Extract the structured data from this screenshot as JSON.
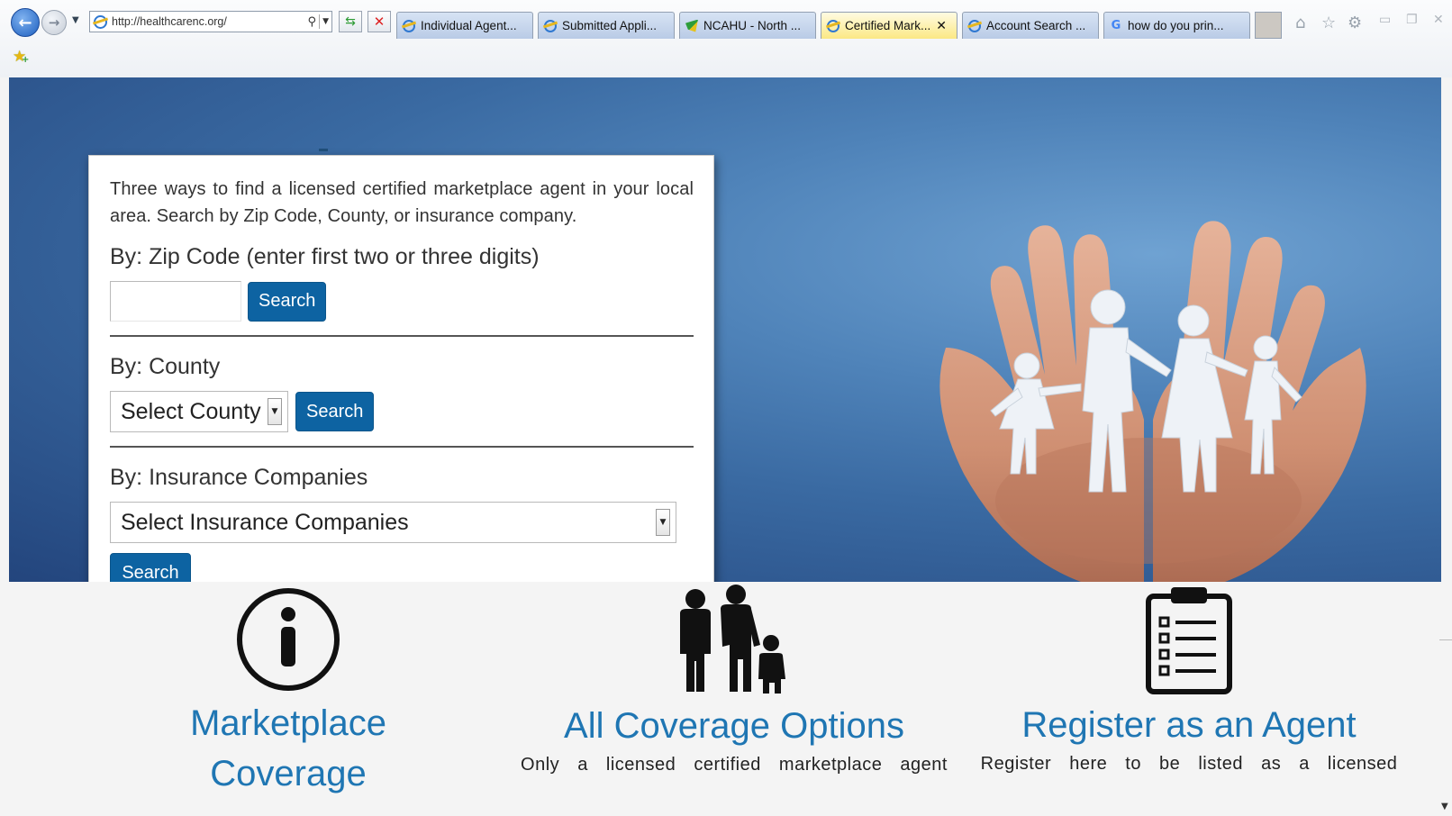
{
  "browser": {
    "address": "http://healthcarenc.org/",
    "tabs": [
      {
        "label": "Individual Agent...",
        "icon": "ie-icon",
        "active": false
      },
      {
        "label": "Submitted Appli...",
        "icon": "ie-icon",
        "active": false
      },
      {
        "label": "NCAHU - North ...",
        "icon": "ncahu-flag-icon",
        "active": false
      },
      {
        "label": "Certified Mark...",
        "icon": "ie-icon",
        "active": true
      },
      {
        "label": "Account Search ...",
        "icon": "ie-icon",
        "active": false
      },
      {
        "label": "how do you prin...",
        "icon": "google-icon",
        "active": false
      }
    ],
    "tab_close": "✕"
  },
  "search_card": {
    "intro": "Three ways to find a licensed certified marketplace agent in your local area. Search by Zip Code, County, or insurance company.",
    "zip": {
      "label": "By: Zip Code (enter first two or three digits)",
      "value": "",
      "button": "Search"
    },
    "county": {
      "label": "By: County",
      "selected": "Select County",
      "button": "Search"
    },
    "insurance": {
      "label": "By: Insurance Companies",
      "selected": "Select Insurance Companies",
      "button": "Search"
    }
  },
  "features": [
    {
      "icon": "info-icon",
      "title_line1": "Marketplace",
      "title_line2": "Coverage",
      "text": ""
    },
    {
      "icon": "family-icon",
      "title_line1": "All Coverage Options",
      "title_line2": "",
      "text": "Only a licensed certified marketplace agent"
    },
    {
      "icon": "clipboard-checklist-icon",
      "title_line1": "Register as an Agent",
      "title_line2": "",
      "text": "Register here to be listed as a licensed"
    }
  ],
  "colors": {
    "accent_blue": "#0d63a2",
    "heading_blue": "#1f76b3",
    "hero_dark": "#23457d",
    "hero_light": "#6fa2d2"
  }
}
